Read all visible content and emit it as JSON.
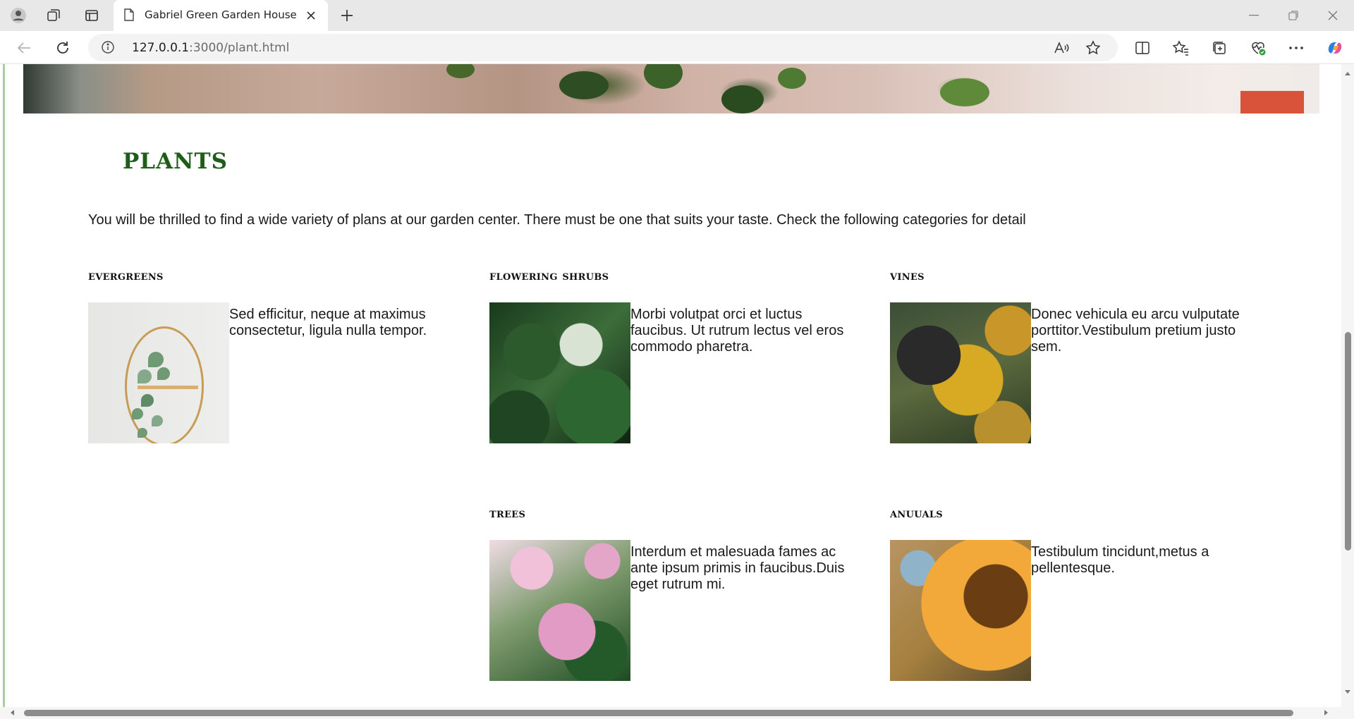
{
  "browser": {
    "tab_title": "Gabriel Green Garden House",
    "url_host": "127.0.0.1",
    "url_path": ":3000/plant.html"
  },
  "page": {
    "title": "PLANTS",
    "intro": "You will be thrilled to find a wide variety of plans at our garden center. There must be one that suits your taste. Check the following categories for detail",
    "categories": [
      {
        "heading": "EVERGREENS",
        "text": "Sed efficitur, neque at maximus consectetur, ligula nulla tempor.",
        "image_icon": "hanging-plant"
      },
      {
        "heading": "FLOWERING SHRUBS",
        "text": "Morbi volutpat orci et luctus faucibus. Ut rutrum lectus vel eros commodo pharetra.",
        "image_icon": "bonsai-shrub"
      },
      {
        "heading": "VINES",
        "text": "Donec vehicula eu arcu vulputate porttitor.Vestibulum pretium justo sem.",
        "image_icon": "bee-on-flower"
      },
      {
        "heading": "TREES",
        "text": "Interdum et malesuada fames ac ante ipsum primis in faucibus.Duis eget rutrum mi.",
        "image_icon": "pink-flowers"
      },
      {
        "heading": "ANUUALS",
        "text": "Testibulum tincidunt,metus a pellentesque.",
        "image_icon": "sunflower"
      }
    ]
  },
  "colors": {
    "title_green": "#1f5e1a",
    "accent_green": "#a9cf9a"
  }
}
